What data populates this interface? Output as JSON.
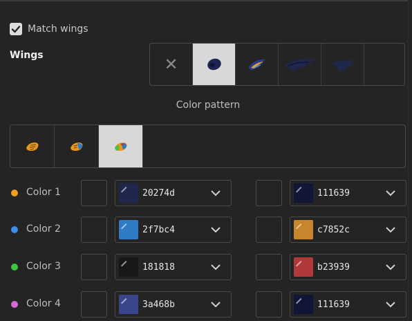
{
  "match_wings": {
    "label": "Match wings",
    "checked": true
  },
  "wings": {
    "label": "Wings",
    "options": [
      {
        "icon": "none-x-icon",
        "glyph": "✕",
        "selected": false
      },
      {
        "icon": "wing-style-1-icon",
        "selected": true
      },
      {
        "icon": "wing-style-2-icon",
        "selected": false
      },
      {
        "icon": "wing-style-3-icon",
        "selected": false
      },
      {
        "icon": "wing-style-4-icon",
        "selected": false
      },
      {
        "icon": "empty-slot",
        "selected": false
      }
    ]
  },
  "color_pattern": {
    "title": "Color pattern",
    "options": [
      {
        "icon": "pattern-1-icon",
        "selected": false
      },
      {
        "icon": "pattern-2-icon",
        "selected": false
      },
      {
        "icon": "pattern-3-icon",
        "selected": true
      }
    ]
  },
  "colors": [
    {
      "label": "Color 1",
      "dot": "#f0a020",
      "primary_hex": "20274d",
      "primary_color": "#20274d",
      "secondary_hex": "111639",
      "secondary_color": "#111639"
    },
    {
      "label": "Color 2",
      "dot": "#3a8ee8",
      "primary_hex": "2f7bc4",
      "primary_color": "#2f7bc4",
      "secondary_hex": "c7852c",
      "secondary_color": "#c7852c"
    },
    {
      "label": "Color 3",
      "dot": "#3ec43e",
      "primary_hex": "181818",
      "primary_color": "#181818",
      "secondary_hex": "b23939",
      "secondary_color": "#b23939"
    },
    {
      "label": "Color 4",
      "dot": "#d46ad4",
      "primary_hex": "3a468b",
      "primary_color": "#3a468b",
      "secondary_hex": "111639",
      "secondary_color": "#111639"
    }
  ]
}
